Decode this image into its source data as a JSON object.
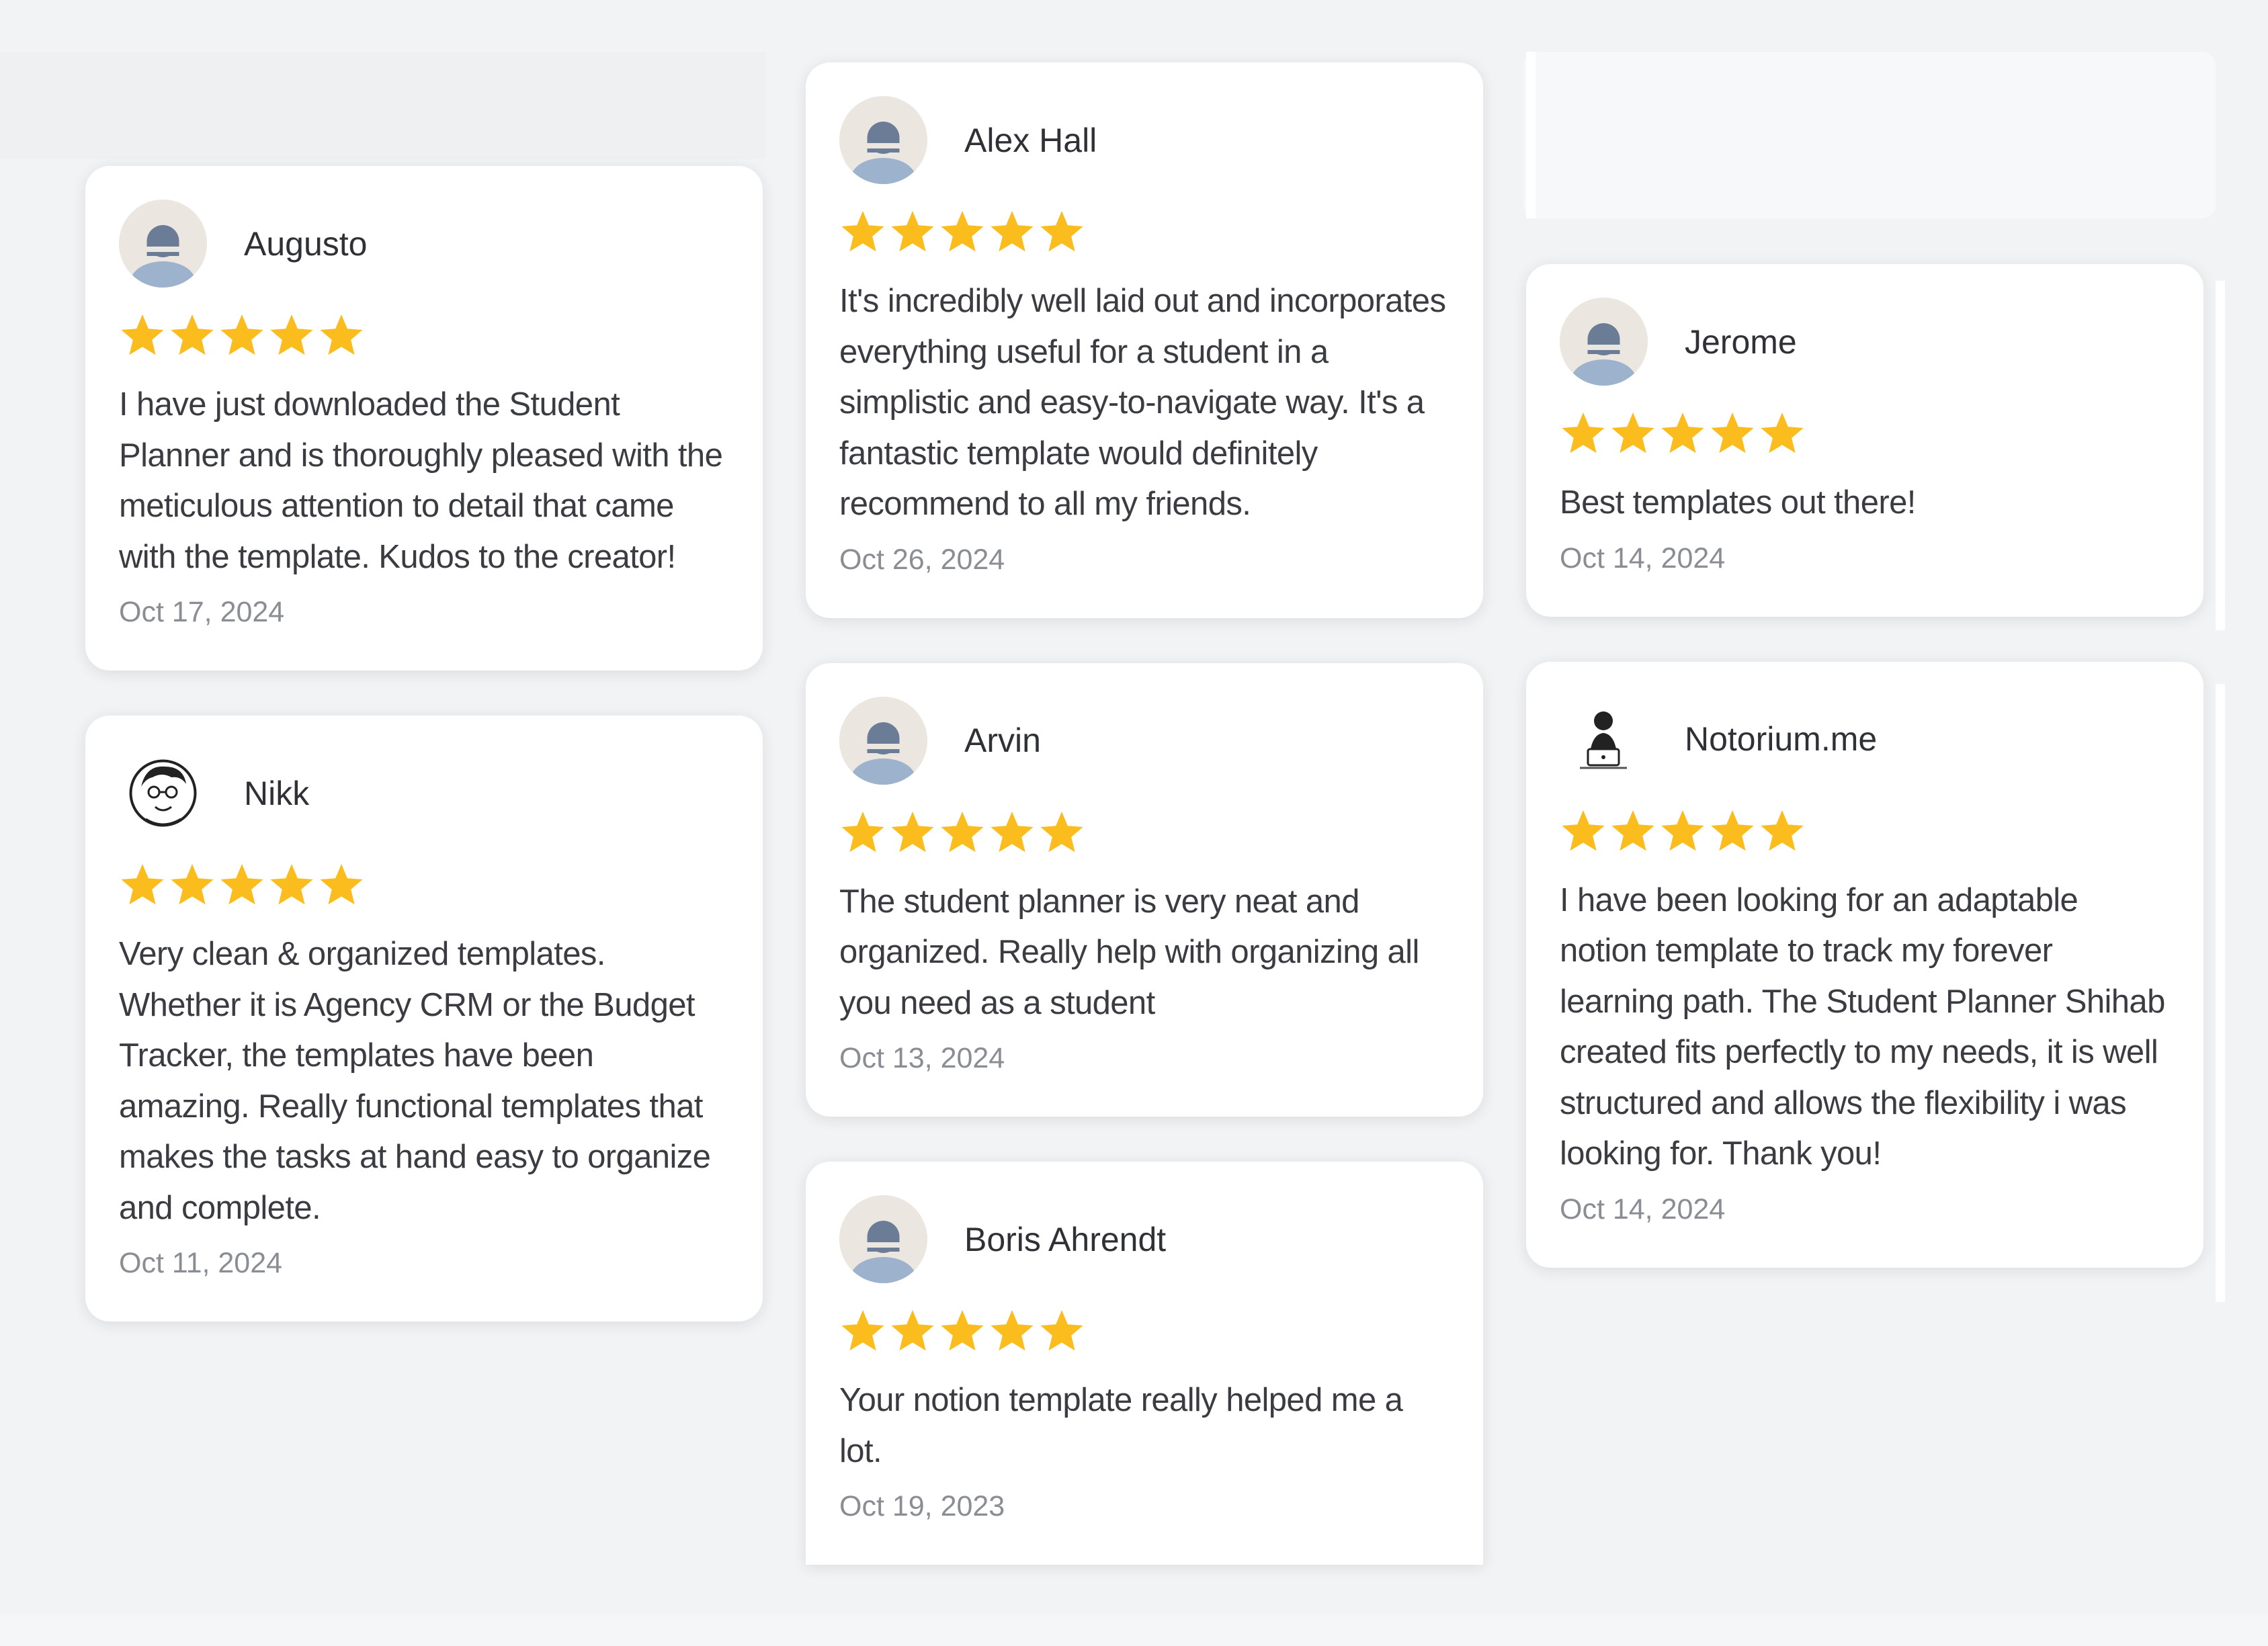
{
  "colors": {
    "background": "#f2f3f4",
    "card": "#ffffff",
    "star": "#fbbc1e",
    "text": "#3a3c41",
    "date": "#8a8d93"
  },
  "reviews": [
    {
      "name": "Augusto",
      "avatar": "default-avatar-icon",
      "rating": 5,
      "text": "I have just downloaded the Student Planner and is thoroughly pleased with the meticulous attention to detail that came with the template. Kudos to the creator!",
      "date": "Oct 17, 2024"
    },
    {
      "name": "Nikk",
      "avatar": "cartoon-face-avatar-icon",
      "rating": 5,
      "text": "Very clean & organized templates. Whether it is Agency CRM or the Budget Tracker, the templates have been amazing. Really functional templates that makes the tasks at hand easy to organize and complete.",
      "date": "Oct 11, 2024"
    },
    {
      "name": "Alex Hall",
      "avatar": "default-avatar-icon",
      "rating": 5,
      "text": "It's incredibly well laid out and incorporates everything useful for a student in a simplistic and easy-to-navigate way. It's a fantastic template would definitely recommend to all my friends.",
      "date": "Oct 26, 2024"
    },
    {
      "name": "Arvin",
      "avatar": "default-avatar-icon",
      "rating": 5,
      "text": "The student planner is very neat and organized. Really help with organizing all you need as a student",
      "date": "Oct 13, 2024"
    },
    {
      "name": "Boris Ahrendt",
      "avatar": "default-avatar-icon",
      "rating": 5,
      "text": "Your notion template really helped me a lot.",
      "date": "Oct 19, 2023"
    },
    {
      "name": "Jerome",
      "avatar": "default-avatar-icon",
      "rating": 5,
      "text": "Best templates out there!",
      "date": "Oct 14, 2024"
    },
    {
      "name": "Notorium.me",
      "avatar": "person-at-laptop-avatar-icon",
      "rating": 5,
      "text": "I have been looking for an adaptable notion template to track my forever learning path. The Student Planner Shihab created fits perfectly to my needs, it is well structured and allows the flexibility i was looking for. Thank you!",
      "date": "Oct 14, 2024"
    }
  ]
}
